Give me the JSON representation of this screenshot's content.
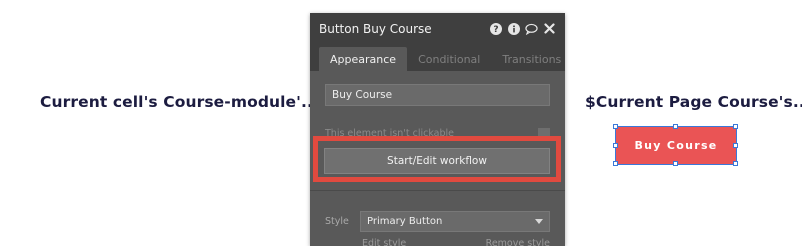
{
  "canvas": {
    "left_text": "Current cell's Course-module'...",
    "right_text": "$Current Page Course's..."
  },
  "selected_button": {
    "label": "Buy Course",
    "color": "#ea5455",
    "selection_color": "#3a78d9"
  },
  "panel": {
    "title": "Button Buy Course",
    "header_icons": [
      "help-icon",
      "info-icon",
      "comment-icon",
      "close-icon"
    ],
    "tabs": [
      {
        "label": "Appearance",
        "active": true
      },
      {
        "label": "Conditional",
        "active": false
      },
      {
        "label": "Transitions",
        "active": false
      }
    ],
    "name_value": "Buy Course",
    "clickable_label": "This element isn't clickable",
    "workflow_button": "Start/Edit workflow",
    "style_label": "Style",
    "style_value": "Primary Button",
    "edit_style": "Edit style",
    "remove_style": "Remove style"
  },
  "highlight_color": "#e14a3f"
}
